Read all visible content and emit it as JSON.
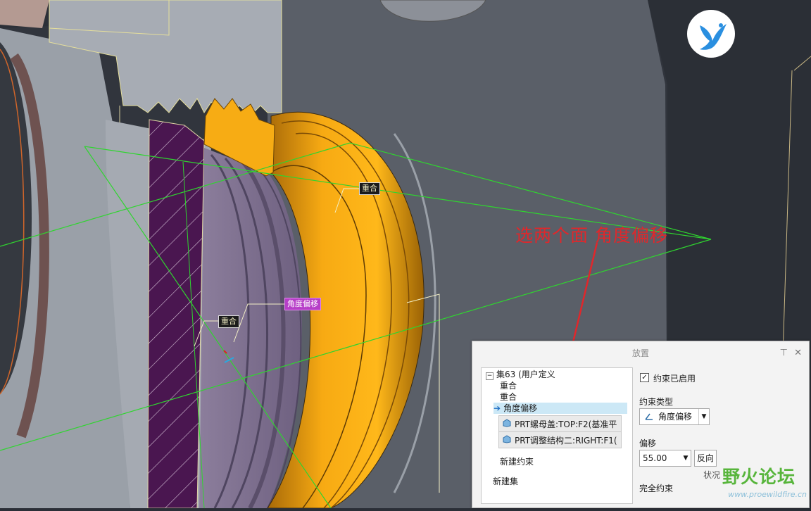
{
  "viewport": {
    "callouts": [
      {
        "text": "重合",
        "kind": "dark"
      },
      {
        "text": "角度偏移",
        "kind": "purple"
      },
      {
        "text": "重合",
        "kind": "dark"
      }
    ],
    "annotation": "选两个面 角度偏移",
    "logo_icon": "bird-logo-icon"
  },
  "panel": {
    "title": "放置",
    "pin_icon": "pin-icon",
    "close_icon": "close-icon",
    "tree": {
      "set": "集63 (用户定义",
      "constraints": [
        "重合",
        "重合",
        "角度偏移"
      ],
      "refs": [
        "PRT螺母盖:TOP:F2(基准平",
        "PRT调整结构二:RIGHT:F1("
      ],
      "new_constraint": "新建约束",
      "new_set": "新建集"
    },
    "enabled_label": "约束已启用",
    "enabled_checked": true,
    "type_label": "约束类型",
    "type_value": "角度偏移",
    "offset_label": "偏移",
    "offset_value": "55.00",
    "flip_label": "反向",
    "status_label": "状况",
    "status_value": "完全约束"
  },
  "watermark": {
    "text": "野火论坛",
    "url": "www.proewildfire.cn"
  },
  "colors": {
    "gear": "#f6a915",
    "hatch": "#4a1650",
    "plane_line": "#29d329",
    "annotation": "#e0272b",
    "selection": "#cce8f6"
  }
}
